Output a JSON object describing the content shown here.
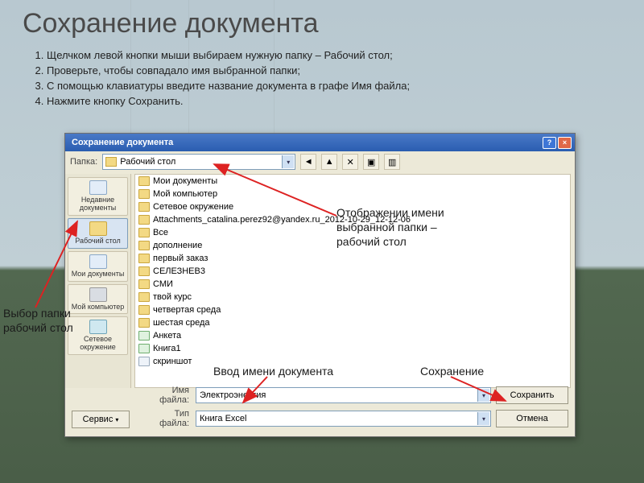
{
  "slide_title": "Сохранение документа",
  "steps": [
    "Щелчком левой кнопки мыши выбираем нужную папку – Рабочий стол;",
    "Проверьте, чтобы совпадало имя выбранной папки;",
    "С помощью клавиатуры введите название документа в графе Имя файла;",
    "Нажмите кнопку Сохранить."
  ],
  "dialog": {
    "title": "Сохранение документа",
    "folder_label": "Папка:",
    "current_folder": "Рабочий стол",
    "places": [
      {
        "label": "Недавние документы",
        "icon": "doc"
      },
      {
        "label": "Рабочий стол",
        "icon": "folder",
        "selected": true
      },
      {
        "label": "Мои документы",
        "icon": "doc"
      },
      {
        "label": "Мой компьютер",
        "icon": "comp"
      },
      {
        "label": "Сетевое окружение",
        "icon": "net"
      }
    ],
    "files": [
      {
        "name": "Мои документы",
        "type": "folder"
      },
      {
        "name": "Мой компьютер",
        "type": "folder"
      },
      {
        "name": "Сетевое окружение",
        "type": "folder"
      },
      {
        "name": "Attachments_catalina.perez92@yandex.ru_2012-10-29_12-12-06",
        "type": "folder"
      },
      {
        "name": "Все",
        "type": "folder"
      },
      {
        "name": "дополнение",
        "type": "folder"
      },
      {
        "name": "первый заказ",
        "type": "folder"
      },
      {
        "name": "СЕЛЕЗНЕВ3",
        "type": "folder"
      },
      {
        "name": "СМИ",
        "type": "folder"
      },
      {
        "name": "твой курс",
        "type": "folder"
      },
      {
        "name": "четвертая среда",
        "type": "folder"
      },
      {
        "name": "шестая среда",
        "type": "folder"
      },
      {
        "name": "Анкета",
        "type": "xls"
      },
      {
        "name": "Книга1",
        "type": "xls"
      },
      {
        "name": "скриншот",
        "type": "file"
      }
    ],
    "service_label": "Сервис",
    "filename_label": "Имя файла:",
    "filename_value": "Электроэнергия",
    "filetype_label": "Тип файла:",
    "filetype_value": "Книга Excel",
    "save_label": "Сохранить",
    "cancel_label": "Отмена"
  },
  "callouts": {
    "left": "Выбор папки рабочий стол",
    "folder_display": "Отображении имени выбранной папки – рабочий стол",
    "filename": "Ввод имени документа",
    "save": "Сохранение"
  }
}
